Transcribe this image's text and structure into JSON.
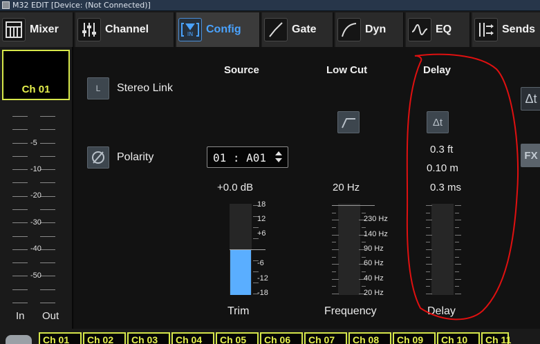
{
  "window": {
    "title": "M32 EDIT [Device: (Not Connected)]"
  },
  "tabs": [
    {
      "label": "Mixer",
      "icon": "mixer-grid-icon"
    },
    {
      "label": "Channel",
      "icon": "channel-sliders-icon"
    },
    {
      "label": "Config",
      "icon": "config-input-icon",
      "active": true
    },
    {
      "label": "Gate",
      "icon": "gate-curve-icon"
    },
    {
      "label": "Dyn",
      "icon": "dynamics-curve-icon"
    },
    {
      "label": "EQ",
      "icon": "eq-curve-icon"
    },
    {
      "label": "Sends",
      "icon": "sends-icon"
    }
  ],
  "strip": {
    "channel_name": "Ch 01",
    "scale": [
      "-5",
      "-10",
      "-20",
      "-30",
      "-40",
      "-50"
    ],
    "in_label": "In",
    "out_label": "Out"
  },
  "config": {
    "source": {
      "heading": "Source",
      "stereo_link_button": "L",
      "stereo_link_label": "Stereo Link",
      "polarity_label": "Polarity",
      "input_select": "01 : A01",
      "trim_value": "+0.0 dB",
      "trim_scale": [
        "18",
        "12",
        "+6",
        "-6",
        "-12",
        "-18"
      ],
      "trim_label": "Trim",
      "trim_level": 0.5
    },
    "lowcut": {
      "heading": "Low Cut",
      "frequency_value": "20 Hz",
      "frequency_scale": [
        "230 Hz",
        "140 Hz",
        "90 Hz",
        "60 Hz",
        "40 Hz",
        "20 Hz"
      ],
      "frequency_label": "Frequency"
    },
    "delay": {
      "heading": "Delay",
      "button_glyph": "Δt",
      "feet": "0.3 ft",
      "meters": "0.10 m",
      "ms": "0.3 ms",
      "label": "Delay"
    },
    "right_buttons": {
      "delay_glyph": "Δt",
      "fx_glyph": "FX"
    }
  },
  "annotation": {
    "color": "#e01010"
  },
  "channel_tabs": [
    "Ch 01",
    "Ch 02",
    "Ch 03",
    "Ch 04",
    "Ch 05",
    "Ch 06",
    "Ch 07",
    "Ch 08",
    "Ch 09",
    "Ch 10",
    "Ch 11"
  ],
  "colors": {
    "accent": "#4aa3ff",
    "channel": "#e5f04d",
    "trim_fill": "#5aaeff"
  }
}
